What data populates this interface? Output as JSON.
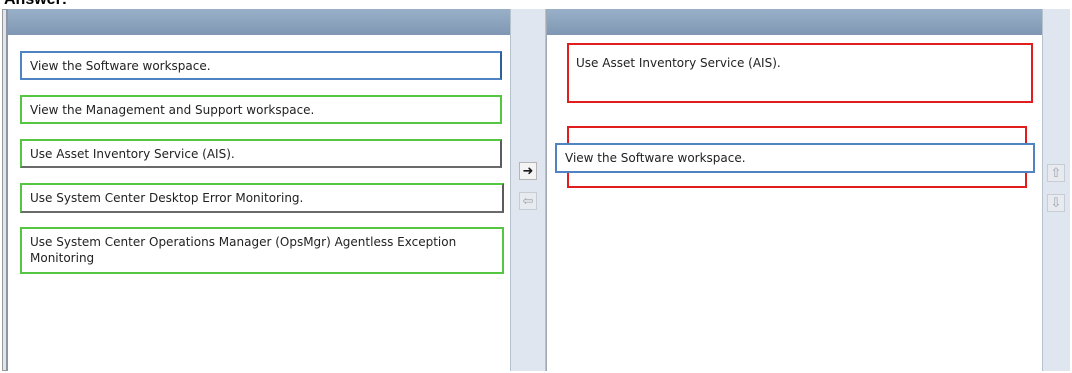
{
  "header": {
    "title": "Answer:"
  },
  "source_items": [
    "View the Software workspace.",
    "View the Management and Support workspace.",
    "Use Asset Inventory Service (AIS).",
    "Use System Center Desktop Error Monitoring.",
    "Use System Center Operations Manager (OpsMgr) Agentless Exception Monitoring"
  ],
  "answer_items": [
    "Use Asset Inventory Service (AIS).",
    "View the Software workspace."
  ],
  "controls": {
    "move_right_icon": "arrow-right-icon",
    "move_left_icon": "arrow-left-icon",
    "move_up_icon": "arrow-up-icon",
    "move_down_icon": "arrow-down-icon"
  },
  "colors": {
    "header": "#8aa2be",
    "green_outline": "#55c642",
    "red_outline": "#e01e1e",
    "blue_outline": "#4f83c2"
  }
}
